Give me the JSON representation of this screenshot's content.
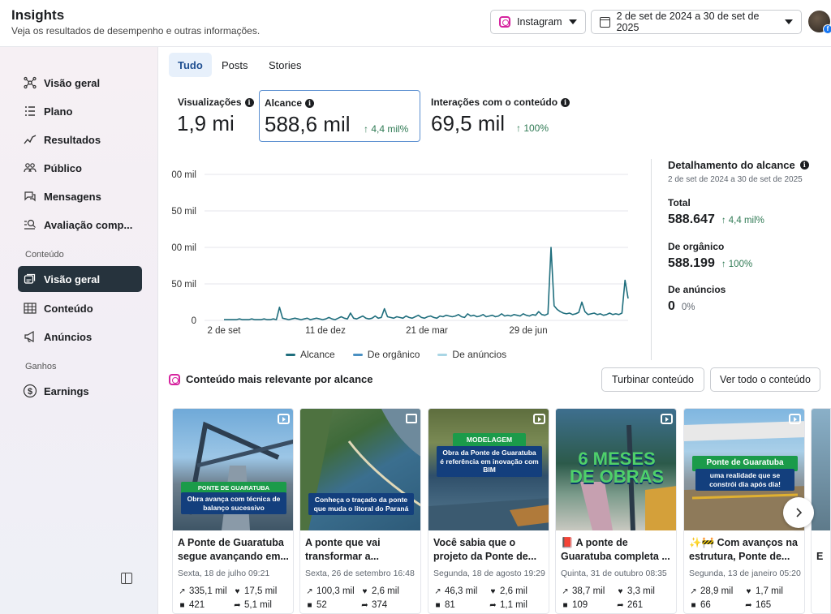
{
  "header": {
    "title": "Insights",
    "subtitle": "Veja os resultados de desempenho e outras informações.",
    "platform": "Instagram",
    "date_range": "2 de set de 2024 a 30 de set de 2025",
    "avatar_badge": "f"
  },
  "sidebar": {
    "items": [
      {
        "label": "Visão geral",
        "icon": "network-icon"
      },
      {
        "label": "Plano",
        "icon": "list-icon"
      },
      {
        "label": "Resultados",
        "icon": "trend-icon"
      },
      {
        "label": "Público",
        "icon": "people-icon"
      },
      {
        "label": "Mensagens",
        "icon": "chat-icon"
      },
      {
        "label": "Avaliação comp...",
        "icon": "search-list-icon"
      }
    ],
    "section_content": "Conteúdo",
    "content_items": [
      {
        "label": "Visão geral",
        "icon": "cards-icon",
        "active": true
      },
      {
        "label": "Conteúdo",
        "icon": "table-icon"
      },
      {
        "label": "Anúncios",
        "icon": "megaphone-icon"
      }
    ],
    "section_earnings": "Ganhos",
    "earnings_items": [
      {
        "label": "Earnings",
        "icon": "dollar-icon"
      }
    ]
  },
  "tabs": [
    "Tudo",
    "Posts",
    "Stories"
  ],
  "metrics": [
    {
      "label": "Visualizações",
      "value": "1,9 mi",
      "delta": ""
    },
    {
      "label": "Alcance",
      "value": "588,6 mil",
      "delta": "↑ 4,4 mil%"
    },
    {
      "label": "Interações com o conteúdo",
      "value": "69,5 mil",
      "delta": "↑ 100%"
    }
  ],
  "chart_data": {
    "type": "line",
    "y_tick_labels": [
      "00 mil",
      "50 mil",
      "00 mil",
      "50 mil",
      "0"
    ],
    "x_tick_labels": [
      "2 de set",
      "11 de dez",
      "21 de mar",
      "29 de jun"
    ],
    "ylim": [
      0,
      200
    ],
    "grid": true,
    "legend_position": "bottom",
    "series": [
      {
        "name": "Alcance",
        "color": "#1f6e7d",
        "values": [
          1,
          1,
          1,
          1,
          1,
          2,
          1,
          1,
          1,
          2,
          1,
          1,
          1,
          2,
          1,
          1,
          2,
          1,
          18,
          3,
          2,
          1,
          2,
          3,
          2,
          1,
          2,
          3,
          1,
          2,
          3,
          2,
          1,
          2,
          4,
          2,
          1,
          3,
          5,
          3,
          2,
          10,
          3,
          2,
          4,
          6,
          3,
          2,
          3,
          6,
          3,
          4,
          16,
          5,
          4,
          3,
          5,
          4,
          3,
          6,
          4,
          3,
          5,
          7,
          4,
          3,
          5,
          6,
          4,
          3,
          6,
          5,
          7,
          6,
          5,
          6,
          8,
          5,
          4,
          9,
          6,
          7,
          5,
          6,
          8,
          5,
          6,
          7,
          5,
          6,
          9,
          6,
          7,
          6,
          8,
          7,
          6,
          9,
          7,
          6,
          8,
          7,
          12,
          8,
          7,
          9,
          100,
          20,
          15,
          12,
          10,
          9,
          10,
          8,
          9,
          11,
          25,
          12,
          8,
          9,
          10,
          8,
          9,
          7,
          8,
          10,
          8,
          9,
          8,
          10,
          55,
          30
        ]
      },
      {
        "name": "De orgânico",
        "color": "#4a90c2",
        "values": []
      },
      {
        "name": "De anúncios",
        "color": "#a9d6e5",
        "values": []
      }
    ]
  },
  "breakdown": {
    "title": "Detalhamento do alcance",
    "range": "2 de set de 2024 a 30 de set de 2025",
    "total_label": "Total",
    "total_value": "588.647",
    "total_delta": "↑ 4,4 mil%",
    "organic_label": "De orgânico",
    "organic_value": "588.199",
    "organic_delta": "↑ 100%",
    "ads_label": "De anúncios",
    "ads_value": "0",
    "ads_delta": "0%"
  },
  "top_content": {
    "title": "Conteúdo mais relevante por alcance",
    "boost_button": "Turbinar conteúdo",
    "see_all_button": "Ver todo o conteúdo",
    "cards": [
      {
        "banner_tag": "PONTE DE GUARATUBA",
        "banner_text": "Obra avança com técnica de balanço sucessivo",
        "title": "A Ponte de Guaratuba segue avançando em...",
        "date": "Sexta, 18 de julho 09:21",
        "views": "335,1 mil",
        "likes": "17,5 mil",
        "comments": "421",
        "shares": "5,1 mil",
        "media": "reel"
      },
      {
        "banner_tag": "",
        "banner_text": "Conheça o traçado da ponte que muda o litoral do Paraná",
        "title": "A ponte que vai transformar a...",
        "date": "Sexta, 26 de setembro 16:48",
        "views": "100,3 mil",
        "likes": "2,6 mil",
        "comments": "52",
        "shares": "374",
        "media": "carousel"
      },
      {
        "banner_tag": "MODELAGEM DIGITAL",
        "banner_text": "Obra da Ponte de Guaratuba é referência em inovação com BIM",
        "title": "Você sabia que o projeto da Ponte de...",
        "date": "Segunda, 18 de agosto 19:29",
        "views": "46,3 mil",
        "likes": "2,6 mil",
        "comments": "81",
        "shares": "1,1 mil",
        "media": "reel"
      },
      {
        "banner_tag": "",
        "banner_text": "6 MESES DE OBRAS",
        "title": "📕 A ponte de Guaratuba completa ...",
        "date": "Quinta, 31 de outubro 08:35",
        "views": "38,7 mil",
        "likes": "3,3 mil",
        "comments": "109",
        "shares": "261",
        "media": "reel"
      },
      {
        "banner_tag": "Ponte de Guaratuba",
        "banner_text": "uma realidade que se constrói dia após dia!",
        "title": "✨🚧 Com avanços na estrutura, Ponte de...",
        "date": "Segunda, 13 de janeiro 05:20",
        "views": "28,9 mil",
        "likes": "1,7 mil",
        "comments": "66",
        "shares": "165",
        "media": "reel"
      }
    ],
    "partial_card_title": "E"
  }
}
